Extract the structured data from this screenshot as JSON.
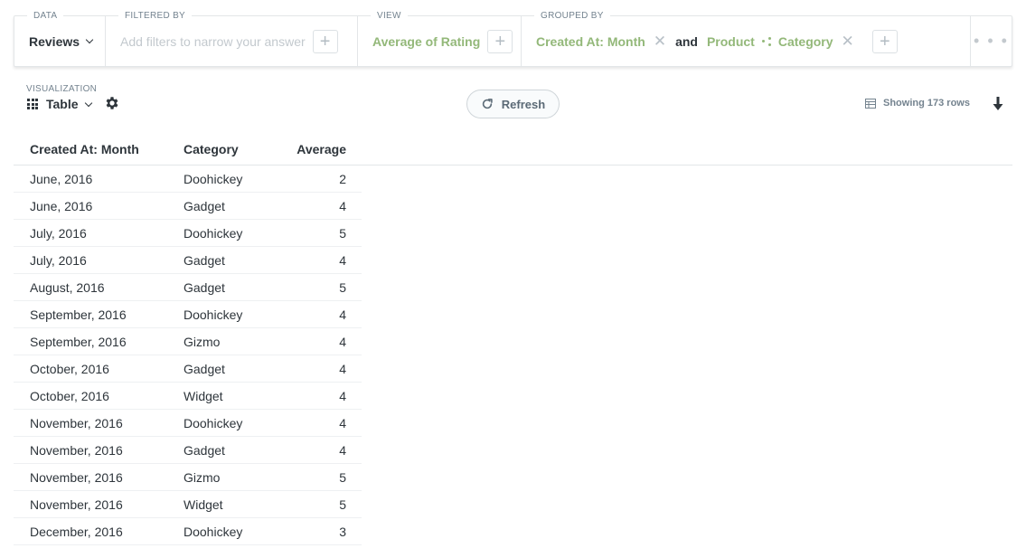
{
  "query": {
    "data": {
      "label": "DATA",
      "value": "Reviews"
    },
    "filter": {
      "label": "FILTERED BY",
      "placeholder": "Add filters to narrow your answer"
    },
    "view": {
      "label": "VIEW",
      "value": "Average of Rating"
    },
    "group": {
      "label": "GROUPED BY",
      "first": "Created At: Month",
      "joiner": "and",
      "second_table": "Product",
      "second_field": "Category"
    },
    "more": "..."
  },
  "visualization": {
    "label": "VISUALIZATION",
    "type": "Table"
  },
  "refresh_label": "Refresh",
  "rows_info": "Showing 173 rows",
  "table": {
    "headers": [
      "Created At: Month",
      "Category",
      "Average"
    ],
    "rows": [
      [
        "June, 2016",
        "Doohickey",
        "2"
      ],
      [
        "June, 2016",
        "Gadget",
        "4"
      ],
      [
        "July, 2016",
        "Doohickey",
        "5"
      ],
      [
        "July, 2016",
        "Gadget",
        "4"
      ],
      [
        "August, 2016",
        "Gadget",
        "5"
      ],
      [
        "September, 2016",
        "Doohickey",
        "4"
      ],
      [
        "September, 2016",
        "Gizmo",
        "4"
      ],
      [
        "October, 2016",
        "Gadget",
        "4"
      ],
      [
        "October, 2016",
        "Widget",
        "4"
      ],
      [
        "November, 2016",
        "Doohickey",
        "4"
      ],
      [
        "November, 2016",
        "Gadget",
        "4"
      ],
      [
        "November, 2016",
        "Gizmo",
        "5"
      ],
      [
        "November, 2016",
        "Widget",
        "5"
      ],
      [
        "December, 2016",
        "Doohickey",
        "3"
      ]
    ]
  },
  "colors": {
    "accent_green": "#93b879",
    "text": "#2e353b",
    "muted": "#74838f",
    "border": "#e3e6e8"
  }
}
